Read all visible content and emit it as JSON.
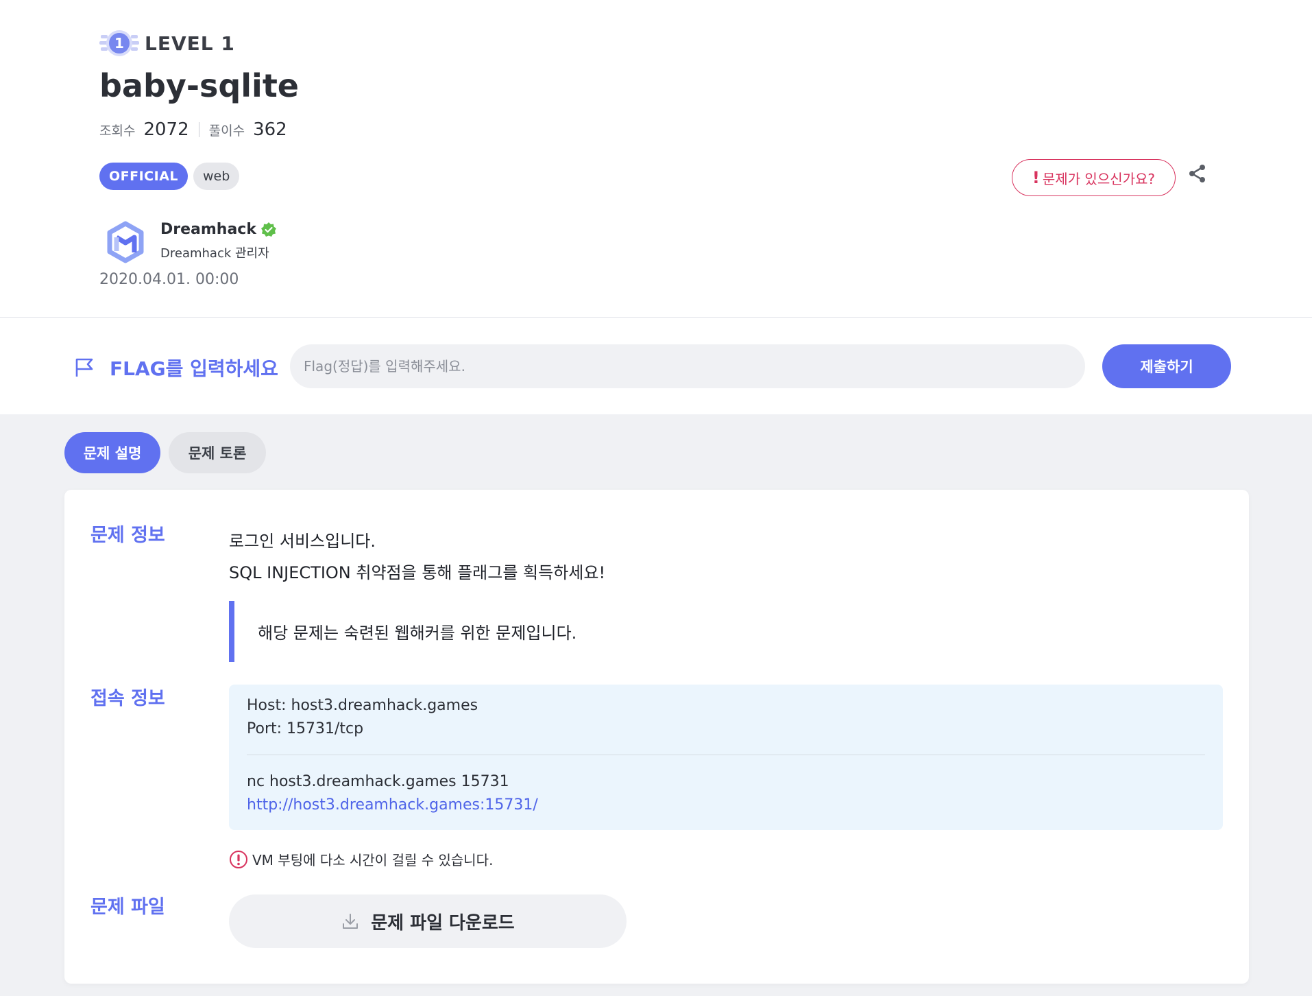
{
  "challenge": {
    "level_label": "LEVEL 1",
    "level_number": "1",
    "title": "baby-sqlite",
    "views_label": "조회수",
    "views": "2072",
    "solves_label": "풀이수",
    "solves": "362",
    "tags": [
      "OFFICIAL",
      "web"
    ],
    "report_label": "문제가 있으신가요?",
    "report_mark": "!",
    "author": {
      "name": "Dreamhack",
      "role": "Dreamhack 관리자"
    },
    "date": "2020.04.01. 00:00"
  },
  "flag": {
    "label": "FLAG를 입력하세요",
    "placeholder": "Flag(정답)를 입력해주세요.",
    "submit_label": "제출하기"
  },
  "tabs": [
    "문제 설명",
    "문제 토론"
  ],
  "info": {
    "label": "문제 정보",
    "lines": [
      "로그인 서비스입니다.",
      "SQL INJECTION 취약점을 통해 플래그를 획득하세요!"
    ],
    "quote": "해당 문제는 숙련된 웹해커를 위한 문제입니다."
  },
  "connection": {
    "label": "접속 정보",
    "host": "Host: host3.dreamhack.games",
    "port": "Port: 15731/tcp",
    "nc": "nc host3.dreamhack.games 15731",
    "url": "http://host3.dreamhack.games:15731/",
    "note": "VM 부팅에 다소 시간이 걸릴 수 있습니다."
  },
  "files": {
    "label": "문제 파일",
    "download_label": "문제 파일 다운로드"
  },
  "colors": {
    "accent": "#6071f0",
    "danger": "#d8335e",
    "panel_bg": "#f0f1f4",
    "conn_bg": "#ebf5fd"
  },
  "icons": [
    "level-badge-icon",
    "share-icon",
    "dreamhack-logo",
    "verified-icon",
    "flag-icon",
    "warning-icon",
    "download-icon"
  ]
}
